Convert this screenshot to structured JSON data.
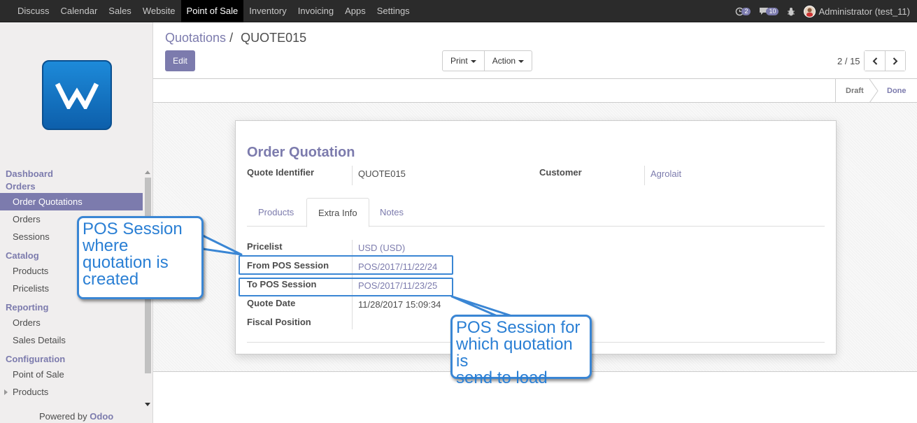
{
  "topnav": {
    "items": [
      "Discuss",
      "Calendar",
      "Sales",
      "Website",
      "Point of Sale",
      "Inventory",
      "Invoicing",
      "Apps",
      "Settings"
    ],
    "active": "Point of Sale",
    "activity_count": "2",
    "messages_count": "10",
    "user": "Administrator (test_11)"
  },
  "sidebar": {
    "logo_icon": "wheel-logo-icon",
    "sections": [
      {
        "title": "Dashboard",
        "items": []
      },
      {
        "title": "Orders",
        "items": [
          "Order Quotations",
          "Orders",
          "Sessions"
        ]
      },
      {
        "title": "Catalog",
        "items": [
          "Products",
          "Pricelists"
        ]
      },
      {
        "title": "Reporting",
        "items": [
          "Orders",
          "Sales Details"
        ]
      },
      {
        "title": "Configuration",
        "items": [
          "Point of Sale",
          "Products"
        ]
      }
    ],
    "active_item": "Order Quotations",
    "powered_prefix": "Powered by",
    "powered_brand": "Odoo"
  },
  "control_panel": {
    "breadcrumb_parent": "Quotations",
    "breadcrumb_sep": "/",
    "breadcrumb_current": "QUOTE015",
    "edit_label": "Edit",
    "print_label": "Print",
    "action_label": "Action",
    "pager": "2 / 15"
  },
  "statusbar": {
    "stages": [
      "Draft",
      "Done"
    ],
    "current": "Done"
  },
  "form": {
    "title": "Order Quotation",
    "quote_identifier_label": "Quote Identifier",
    "quote_identifier": "QUOTE015",
    "customer_label": "Customer",
    "customer": "Agrolait",
    "tabs": [
      "Products",
      "Extra Info",
      "Notes"
    ],
    "active_tab": "Extra Info",
    "fields": [
      {
        "label": "Pricelist",
        "value": "USD (USD)",
        "link": true
      },
      {
        "label": "From POS Session",
        "value": "POS/2017/11/22/24",
        "link": true
      },
      {
        "label": "To POS Session",
        "value": "POS/2017/11/23/25",
        "link": true
      },
      {
        "label": "Quote Date",
        "value": "11/28/2017 15:09:34",
        "link": false
      },
      {
        "label": "Fiscal Position",
        "value": "",
        "link": false
      }
    ]
  },
  "callouts": {
    "from_session": [
      "POS Session",
      "where",
      "quotation is",
      "created"
    ],
    "to_session": [
      "POS Session for",
      "which quotation is",
      "send to load"
    ]
  },
  "colors": {
    "brand": "#7c7bad",
    "navbar": "#2b2b2b",
    "callout_border": "#3a86d4"
  }
}
